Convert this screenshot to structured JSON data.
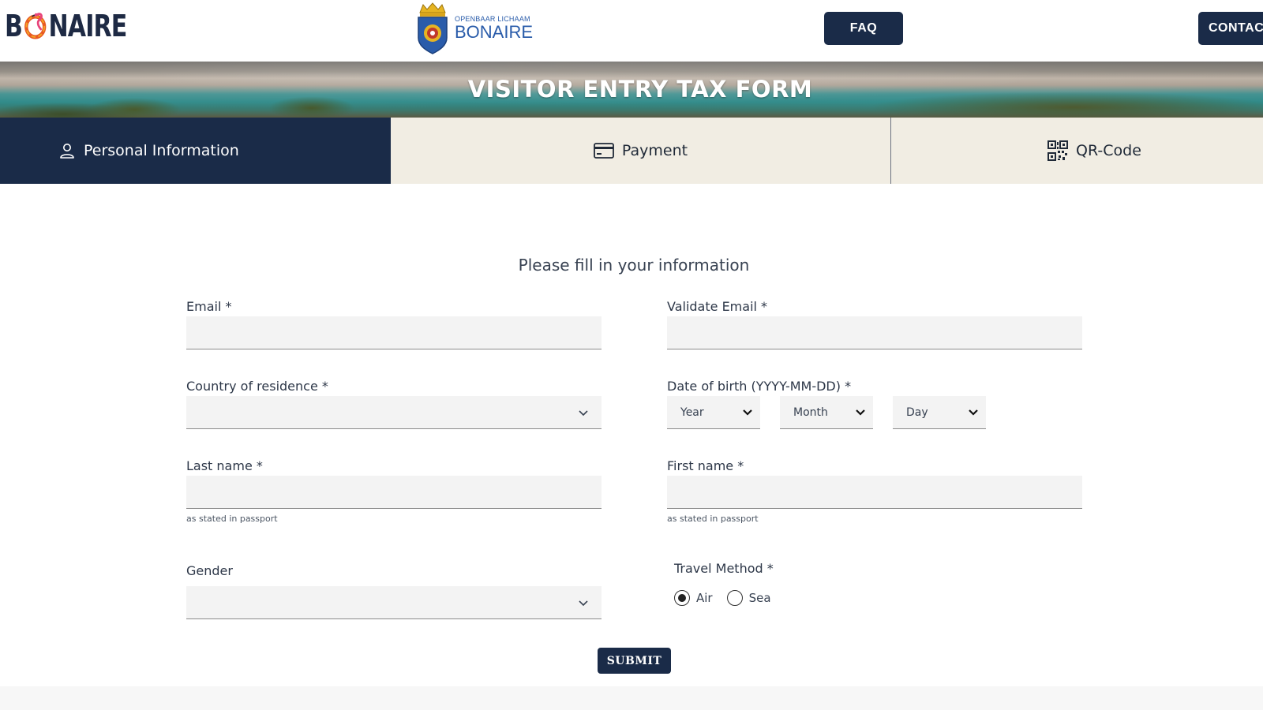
{
  "header": {
    "brand_left": "B",
    "brand_right": "NAIRE",
    "gov_small": "OPENBAAR LICHAAM",
    "gov_big": "BONAIRE",
    "faq_label": "FAQ",
    "contact_label": "CONTACT"
  },
  "banner": {
    "title": "VISITOR ENTRY TAX FORM"
  },
  "steps": [
    {
      "label": "Personal Information",
      "icon": "user-icon",
      "active": true
    },
    {
      "label": "Payment",
      "icon": "credit-card-icon",
      "active": false
    },
    {
      "label": "QR-Code",
      "icon": "qr-code-icon",
      "active": false
    }
  ],
  "form": {
    "heading": "Please fill in your information",
    "email_label": "Email *",
    "email_value": "",
    "validate_email_label": "Validate Email *",
    "validate_email_value": "",
    "country_label": "Country of residence *",
    "country_value": "",
    "dob_label": "Date of birth (YYYY-MM-DD) *",
    "dob_year": "Year",
    "dob_month": "Month",
    "dob_day": "Day",
    "last_name_label": "Last name *",
    "last_name_value": "",
    "last_name_helper": "as stated in passport",
    "first_name_label": "First name *",
    "first_name_value": "",
    "first_name_helper": "as stated in passport",
    "gender_label": "Gender",
    "gender_value": "",
    "travel_label": "Travel Method *",
    "travel_options": [
      {
        "label": "Air",
        "selected": true
      },
      {
        "label": "Sea",
        "selected": false
      }
    ],
    "submit_label": "SUBMIT"
  },
  "colors": {
    "navy": "#1a2b48",
    "tab_inactive_bg": "#f1ede3",
    "input_bg": "#f3f3f3"
  }
}
